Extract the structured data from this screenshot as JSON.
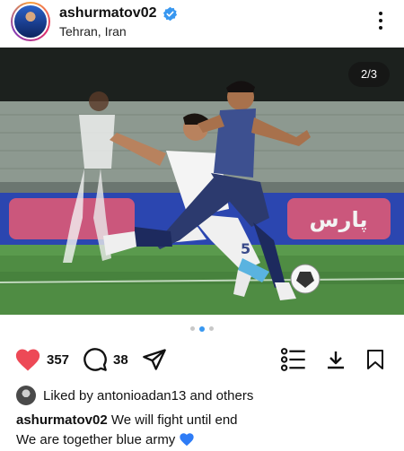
{
  "post": {
    "username": "ashurmatov02",
    "location": "Tehran, Iran",
    "verified": true,
    "carousel": {
      "current": 2,
      "total": 3,
      "label": "2/3",
      "dots": 3,
      "active_dot": 2
    },
    "banner_text": "پارس",
    "jersey_number": "5"
  },
  "actions": {
    "likes_count": "357",
    "comments_count": "38",
    "like_icon": "heart-icon-filled",
    "comment_icon": "comment-icon",
    "share_icon": "send-icon",
    "list_icon": "list-icon",
    "download_icon": "download-icon",
    "save_icon": "bookmark-icon"
  },
  "likes_line": {
    "prefix": "Liked by ",
    "user": "antonioadan13",
    "suffix": " and others"
  },
  "caption": {
    "user": "ashurmatov02",
    "line1": " We will fight until end",
    "line2": "We are together blue army"
  },
  "colors": {
    "like_red": "#ed4956",
    "verified_blue": "#3897f0",
    "active_dot": "#3897f0",
    "blue_heart": "#2e7cf6"
  }
}
